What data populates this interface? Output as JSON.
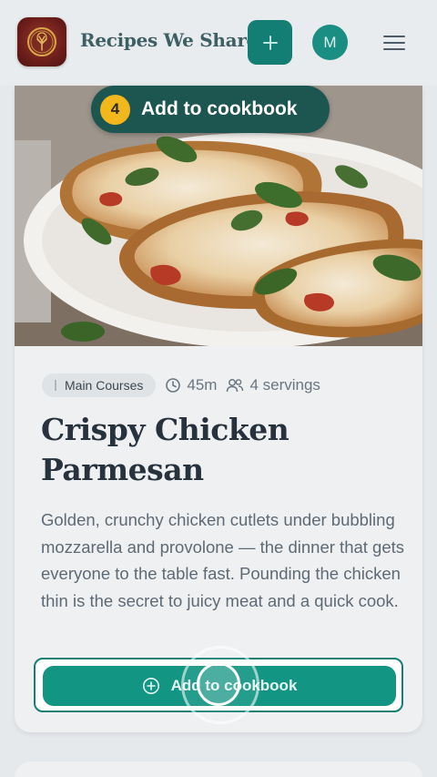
{
  "header": {
    "brand": "Recipes We Share",
    "avatar_initial": "M"
  },
  "recipe": {
    "category": "Main Courses",
    "time": "45m",
    "servings": "4 servings",
    "title": "Crispy Chicken Parmesan",
    "description": "Golden, crunchy chicken cutlets under bubbling mozzarella and provolone — the dinner that gets everyone to the table fast. Pounding the chicken thin is the secret to juicy meat and a quick cook.",
    "cta_label": "Add to cookbook"
  },
  "tour": {
    "step": "4",
    "label": "Add to cookbook"
  },
  "colors": {
    "accent": "#139584",
    "accent_dark": "#127e74",
    "tooltip_bg": "#1d5650",
    "step_badge": "#f2b71a"
  }
}
